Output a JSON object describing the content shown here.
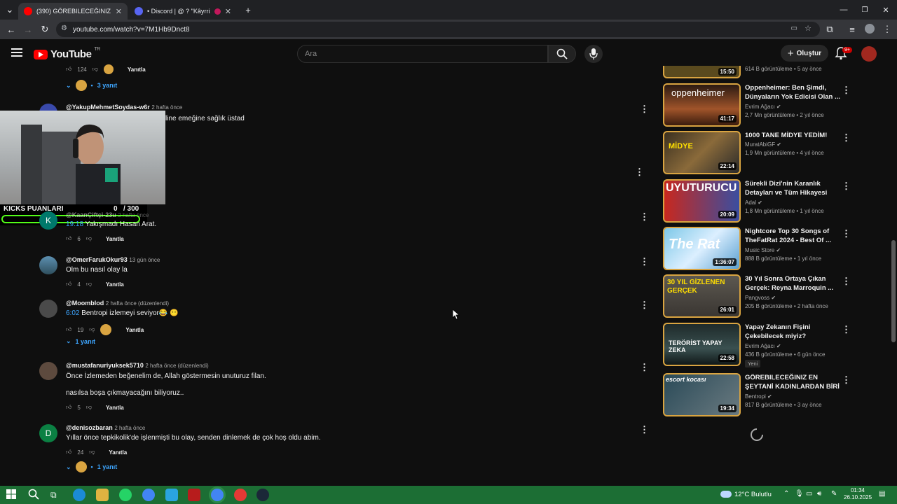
{
  "browser": {
    "tabs": [
      {
        "label": "(390) GÖREBILECEĞINIZ EN ŞEYT",
        "active": true
      },
      {
        "label": "• Discord | @ ? \"Kâyrrix\"",
        "active": false
      }
    ],
    "url": "youtube.com/watch?v=7M1Hb9Dnct8"
  },
  "youtube": {
    "brand": "YouTube",
    "region": "TR",
    "search_placeholder": "Ara",
    "create_label": "Oluştur",
    "notif_count": "9+"
  },
  "comments": [
    {
      "likes": "124",
      "reply_label": "Yanıtla",
      "replies_label": "3 yanıt"
    },
    {
      "author": "@YakupMehmetSoydas-w6r",
      "time": "2 hafta önce",
      "text": "line emeğine sağlık üstad"
    },
    {
      "author": "@KaanÇiftçi-23u",
      "time": "2 hafta önce",
      "timestamp": "19:18",
      "text": "Yakışmadı Hasan Arat.",
      "likes": "6",
      "reply_label": "Yanıtla",
      "avatar_letter": "K"
    },
    {
      "author": "@OmerFarukOkur93",
      "time": "13 gün önce",
      "text": "Olm bu nasıl olay la",
      "likes": "4",
      "reply_label": "Yanıtla"
    },
    {
      "author": "@Moomblod",
      "time": "2 hafta önce (düzenlendi)",
      "timestamp": "6:02",
      "text": "Bentropi izlemeyi seviyor😂 😶",
      "likes": "19",
      "reply_label": "Yanıtla",
      "replies_label": "1 yanıt"
    },
    {
      "author": "@mustafanuriyuksek5710",
      "time": "2 hafta önce (düzenlendi)",
      "text": "Önce İzlemeden beğenelim de, Allah göstermesin unuturuz filan.",
      "text2": "nasılsa boşa çıkmayacağını biliyoruz..",
      "likes": "5",
      "reply_label": "Yanıtla"
    },
    {
      "author": "@denisozbaran",
      "time": "2 hafta önce",
      "text": "Yıllar önce tepkikolik'de işlenmişti bu olay, senden dinlemek de çok hoş oldu abim.",
      "likes": "24",
      "reply_label": "Yanıtla",
      "replies_label": "1 yanıt",
      "avatar_letter": "D"
    }
  ],
  "overlay": {
    "kicks_label": "KICKS PUANLARI",
    "kicks_value": "0",
    "kicks_total": "/ 300"
  },
  "recommendations": [
    {
      "meta": "614 B görüntüleme • 5 ay önce",
      "duration": "15:50"
    },
    {
      "title": "Oppenheimer: Ben Şimdi, Dünyaların Yok Edicisi Olan ...",
      "channel": "Evrim Ağacı",
      "meta": "2,7 Mn görüntüleme • 2 yıl önce",
      "duration": "41:17",
      "thumb_text": "oppenheimer"
    },
    {
      "title": "1000 TANE MİDYE YEDİM!",
      "channel": "MuratAbiGF",
      "meta": "1,9 Mn görüntüleme • 4 yıl önce",
      "duration": "22:14",
      "thumb_text": "MİDYE"
    },
    {
      "title": "Sürekli Dizi'nin Karanlık Detayları ve Tüm Hikayesi",
      "channel": "Adal",
      "meta": "1,8 Mn görüntüleme • 1 yıl önce",
      "duration": "20:09",
      "thumb_text": "UYUTURUCU"
    },
    {
      "title": "Nightcore Top 30 Songs of TheFatRat 2024 - Best Of ...",
      "channel": "Music Store",
      "meta": "888 B görüntüleme • 1 yıl önce",
      "duration": "1:36:07",
      "thumb_text": "The Rat"
    },
    {
      "title": "30 Yıl Sonra Ortaya Çıkan Gerçek: Reyna Marroquin ...",
      "channel": "Pangvoss",
      "meta": "205 B görüntüleme • 2 hafta önce",
      "duration": "26:01",
      "thumb_text": "30 YIL GİZLENEN GERÇEK"
    },
    {
      "title": "Yapay Zekanın Fişini Çekebilecek miyiz?",
      "channel": "Evrim Ağacı",
      "meta": "436 B görüntüleme • 6 gün önce",
      "duration": "22:58",
      "badge": "Yeni",
      "thumb_text": "TERÖRİST YAPAY ZEKA"
    },
    {
      "title": "GÖREBILECEĞINIZ EN ŞEYTANİ KADINLARDAN BİRİ",
      "channel": "Bentropi",
      "meta": "817 B görüntüleme • 3 ay önce",
      "duration": "19:34",
      "thumb_text": "escort kocası"
    }
  ],
  "taskbar": {
    "weather": "12°C Bulutlu",
    "time": "01:34",
    "date": "26.10.2025"
  }
}
